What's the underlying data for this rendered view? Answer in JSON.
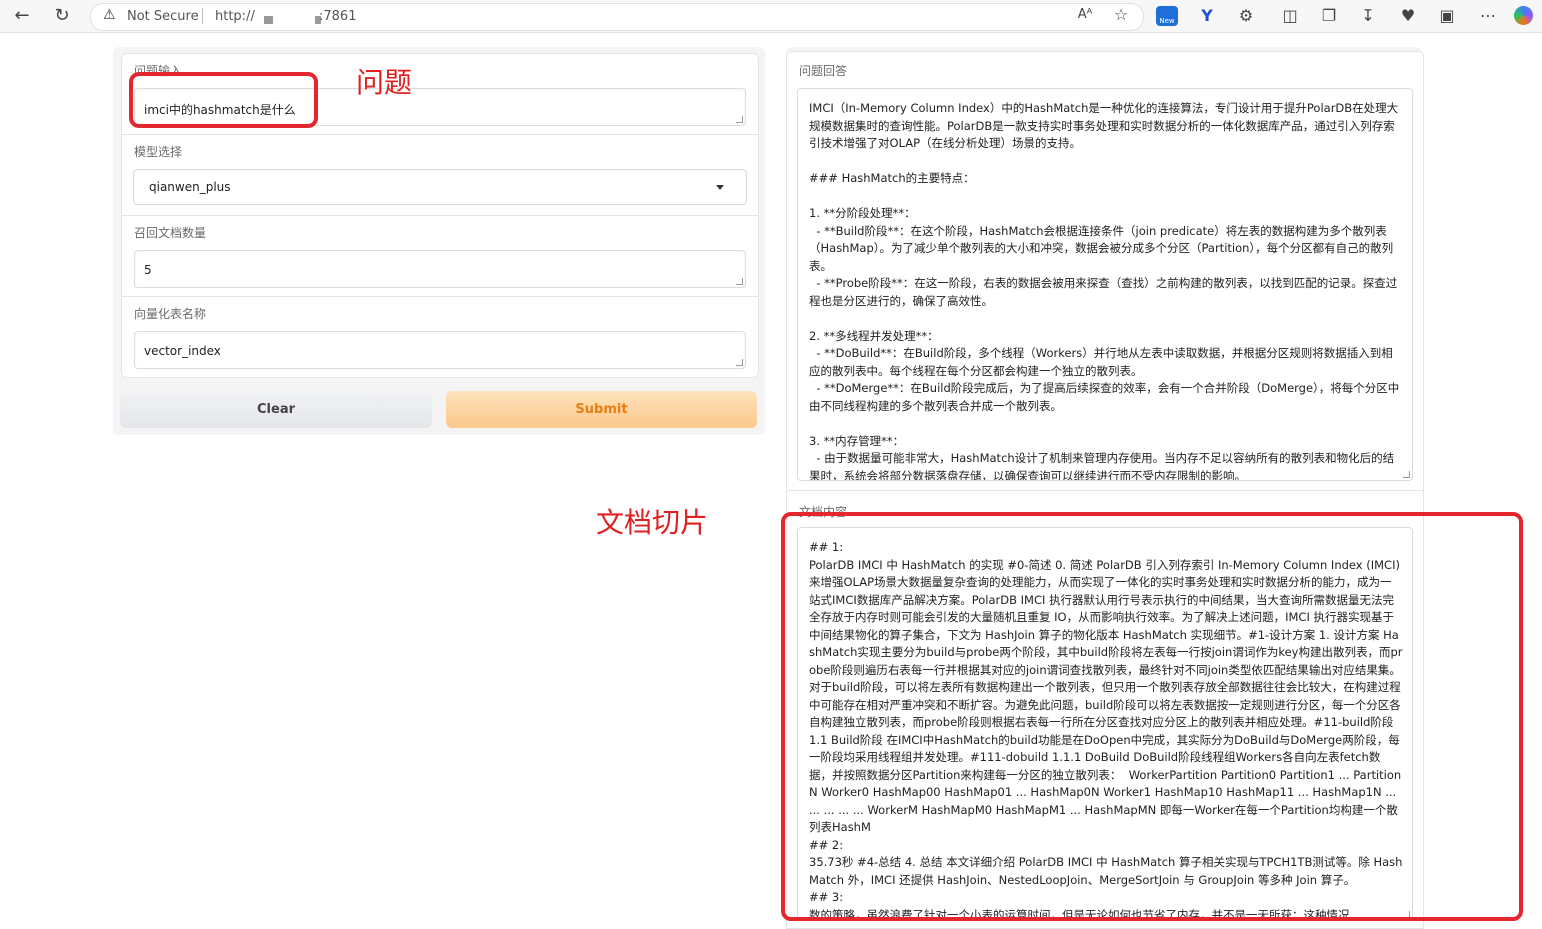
{
  "browser": {
    "security_label": "Not Secure",
    "url_scheme": "http://",
    "url_port": ":7861",
    "new_badge": "New"
  },
  "form": {
    "question": {
      "label": "问题输入",
      "value": "imci中的hashmatch是什么"
    },
    "model": {
      "label": "模型选择",
      "value": "qianwen_plus"
    },
    "recall_count": {
      "label": "召回文档数量",
      "value": "5"
    },
    "vector_table": {
      "label": "向量化表名称",
      "value": "vector_index"
    },
    "clear_label": "Clear",
    "submit_label": "Submit"
  },
  "annotations": {
    "question_note": "问题",
    "chunks_note": "文档切片",
    "color": "#e5262c"
  },
  "answer": {
    "label": "问题回答",
    "text": "IMCI（In-Memory Column Index）中的HashMatch是一种优化的连接算法，专门设计用于提升PolarDB在处理大规模数据集时的查询性能。PolarDB是一款支持实时事务处理和实时数据分析的一体化数据库产品，通过引入列存索引技术增强了对OLAP（在线分析处理）场景的支持。\n\n### HashMatch的主要特点：\n\n1. **分阶段处理**：\n  - **Build阶段**：在这个阶段，HashMatch会根据连接条件（join predicate）将左表的数据构建为多个散列表（HashMap）。为了减少单个散列表的大小和冲突，数据会被分成多个分区（Partition），每个分区都有自己的散列表。\n  - **Probe阶段**：在这一阶段，右表的数据会被用来探查（查找）之前构建的散列表，以找到匹配的记录。探查过程也是分区进行的，确保了高效性。\n\n2. **多线程并发处理**：\n  - **DoBuild**：在Build阶段，多个线程（Workers）并行地从左表中读取数据，并根据分区规则将数据插入到相应的散列表中。每个线程在每个分区都会构建一个独立的散列表。\n  - **DoMerge**：在Build阶段完成后，为了提高后续探查的效率，会有一个合并阶段（DoMerge），将每个分区中由不同线程构建的多个散列表合并成一个散列表。\n\n3. **内存管理**：\n  - 由于数据量可能非常大，HashMatch设计了机制来管理内存使用。当内存不足以容纳所有的散列表和物化后的结果时，系统会将部分数据落盘存储，以确保查询可以继续进行而不受内存限制的影响。"
  },
  "docs": {
    "label": "文档内容",
    "text": "## 1:\nPolarDB IMCI 中 HashMatch 的实现 #0-简述 0. 简述 PolarDB 引入列存索引 In-Memory Column Index (IMCI) 来增强OLAP场景大数据量复杂查询的处理能力，从而实现了一体化的实时事务处理和实时数据分析的能力，成为一站式IMCI数据库产品解决方案。PolarDB IMCI 执行器默认用行号表示执行的中间结果，当大查询所需数据量无法完全存放于内存时则可能会引发的大量随机且重复 IO，从而影响执行效率。为了解决上述问题，IMCI 执行器实现基于中间结果物化的算子集合，下文为 HashJoin 算子的物化版本 HashMatch 实现细节。#1-设计方案 1. 设计方案 HashMatch实现主要分为build与probe两个阶段，其中build阶段将左表每一行按join谓词作为key构建出散列表，而probe阶段则遍历右表每一行并根据其对应的join谓词查找散列表，最终针对不同join类型依匹配结果输出对应结果集。对于build阶段，可以将左表所有数据构建出一个散列表，但只用一个散列表存放全部数据往往会比较大，在构建过程中可能存在相对严重冲突和不断扩容。为避免此问题，build阶段可以将左表数据按一定规则进行分区，每一个分区各自构建独立散列表，而probe阶段则根据右表每一行所在分区查找对应分区上的散列表并相应处理。#11-build阶段 1.1 Build阶段 在IMCI中HashMatch的build功能是在DoOpen中完成，其实际分为DoBuild与DoMerge两阶段，每一阶段均采用线程组并发处理。#111-dobuild 1.1.1 DoBuild DoBuild阶段线程组Workers各自向左表fetch数据，并按照数据分区Partition来构建每一分区的独立散列表：  WorkerPartition Partition0 Partition1 ... PartitionN Worker0 HashMap00 HashMap01 ... HashMap0N Worker1 HashMap10 HashMap11 ... HashMap1N ... ... ... ... ... WorkerM HashMapM0 HashMapM1 ... HashMapMN 即每一Worker在每一个Partition均构建一个散列表HashM\n## 2:\n35.73秒 #4-总结 4. 总结 本文详细介绍 PolarDB IMCI 中 HashMatch 算子相关实现与TPCH1TB测试等。除 HashMatch 外，IMCI 还提供 HashJoin、NestedLoopJoin、MergeSortJoin 与 GroupJoin 等多种 Join 算子。\n## 3:\n数的策略，虽然浪费了针对一个小表的运算时间，但是无论如何也节省了内存，并不是一无所获；这种情况"
  }
}
